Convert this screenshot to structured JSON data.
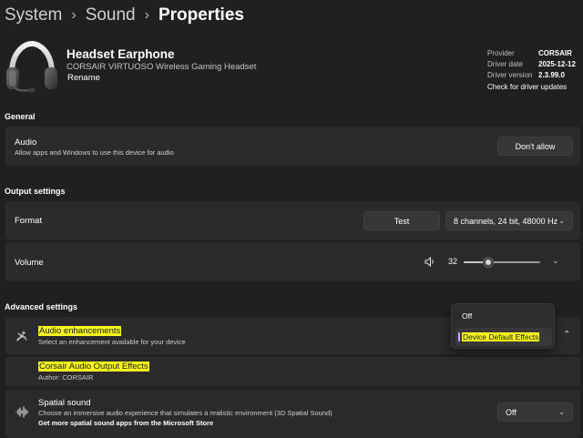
{
  "breadcrumb": {
    "items": [
      "System",
      "Sound"
    ],
    "current": "Properties"
  },
  "device": {
    "name": "Headset Earphone",
    "subtitle": "CORSAIR VIRTUOSO Wireless Gaming Headset",
    "rename_label": "Rename",
    "icon": "headset-icon"
  },
  "driver_info": {
    "provider_label": "Provider",
    "provider_value": "CORSAIR",
    "date_label": "Driver date",
    "date_value": "2025-12-12",
    "version_label": "Driver version",
    "version_value": "2.3.99.0",
    "check_updates_label": "Check for driver updates"
  },
  "general": {
    "title": "General",
    "audio": {
      "title": "Audio",
      "description": "Allow apps and Windows to use this device for audio",
      "button_label": "Don't allow"
    }
  },
  "output": {
    "title": "Output settings",
    "format": {
      "label": "Format",
      "test_label": "Test",
      "selected": "8 channels, 24 bit, 48000 Hz"
    },
    "volume": {
      "label": "Volume",
      "value": "32",
      "level_fraction": 0.32,
      "icon": "speaker-icon"
    }
  },
  "advanced": {
    "title": "Advanced settings",
    "enhancements": {
      "title": "Audio enhancements",
      "description": "Select an enhancement available for your device",
      "icon": "enhancements-icon",
      "dropdown": {
        "options": [
          "Off",
          "Device Default Effects"
        ],
        "selected": "Device Default Effects"
      }
    },
    "effects": {
      "title": "Corsair Audio Output Effects",
      "author": "Author: CORSAIR"
    },
    "spatial": {
      "title": "Spatial sound",
      "description": "Choose an immersive audio experience that simulates a realistic environment (3D Spatial Sound)",
      "store_link": "Get more spatial sound apps from the Microsoft Store",
      "selected": "Off",
      "icon": "spatial-sound-icon"
    }
  },
  "colors": {
    "background": "#202020",
    "card": "#2b2b2b",
    "highlight": "#f7f71e",
    "accent": "#c9a8f5"
  }
}
